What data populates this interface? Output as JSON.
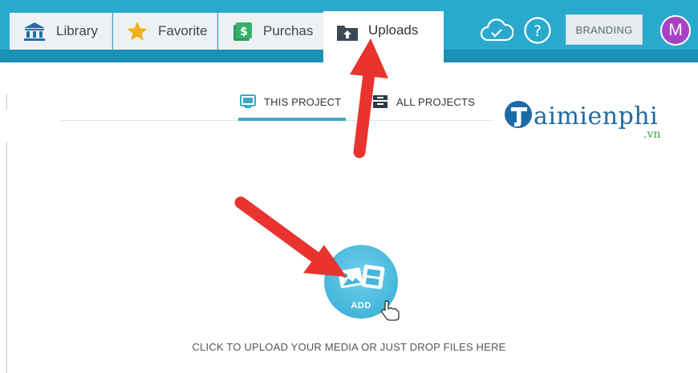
{
  "topbar": {
    "tabs": [
      {
        "label": "Library",
        "icon": "library-icon"
      },
      {
        "label": "Favorite",
        "icon": "star-icon"
      },
      {
        "label": "Purchas",
        "icon": "money-icon"
      },
      {
        "label": "Uploads",
        "icon": "folder-upload-icon",
        "active": true
      }
    ],
    "branding_label": "BRANDING",
    "avatar_initial": "M",
    "icons": [
      "cloud-sync-icon",
      "help-icon"
    ]
  },
  "subtabs": [
    {
      "label": "THIS PROJECT",
      "icon": "monitor-icon",
      "active": true
    },
    {
      "label": "ALL PROJECTS",
      "icon": "archive-icon",
      "active": false
    }
  ],
  "add": {
    "label": "ADD",
    "hint": "CLICK TO UPLOAD YOUR MEDIA OR JUST DROP FILES HERE"
  },
  "watermark": {
    "brand": "aimienphi",
    "initial": "T",
    "tld": ".vn"
  },
  "colors": {
    "topbar": "#2aa9cf",
    "accent": "#39a9c9",
    "avatar": "#a742c7",
    "arrow": "#e8332e",
    "logo": "#1c6aa6",
    "logo_tld": "#3aa33a"
  }
}
